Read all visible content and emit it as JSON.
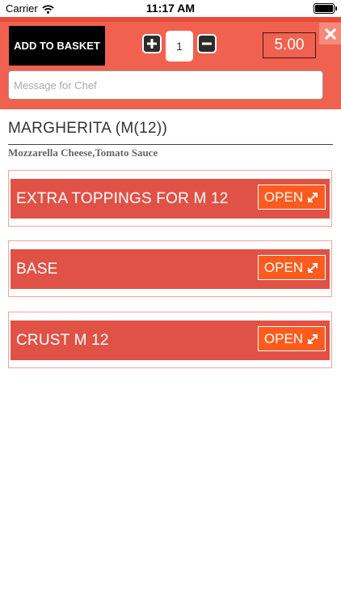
{
  "status_bar": {
    "carrier": "Carrier",
    "time": "11:17 AM"
  },
  "header": {
    "add_to_basket_label": "ADD TO BASKET",
    "quantity": "1",
    "price": "5.00",
    "message_placeholder": "Message for Chef",
    "message_value": ""
  },
  "product": {
    "title": "MARGHERITA (M(12))",
    "description": "Mozzarella Cheese,Tomato Sauce"
  },
  "options": [
    {
      "label": "EXTRA TOPPINGS FOR M 12",
      "button": "OPEN"
    },
    {
      "label": "BASE",
      "button": "OPEN"
    },
    {
      "label": "CRUST M 12",
      "button": "OPEN"
    }
  ],
  "colors": {
    "header_bg": "#f1614f",
    "option_bar": "#e05246",
    "open_button": "#ff5b1e"
  },
  "icons": [
    "wifi-icon",
    "battery-icon",
    "plus-icon",
    "minus-icon",
    "close-icon",
    "expand-icon"
  ]
}
